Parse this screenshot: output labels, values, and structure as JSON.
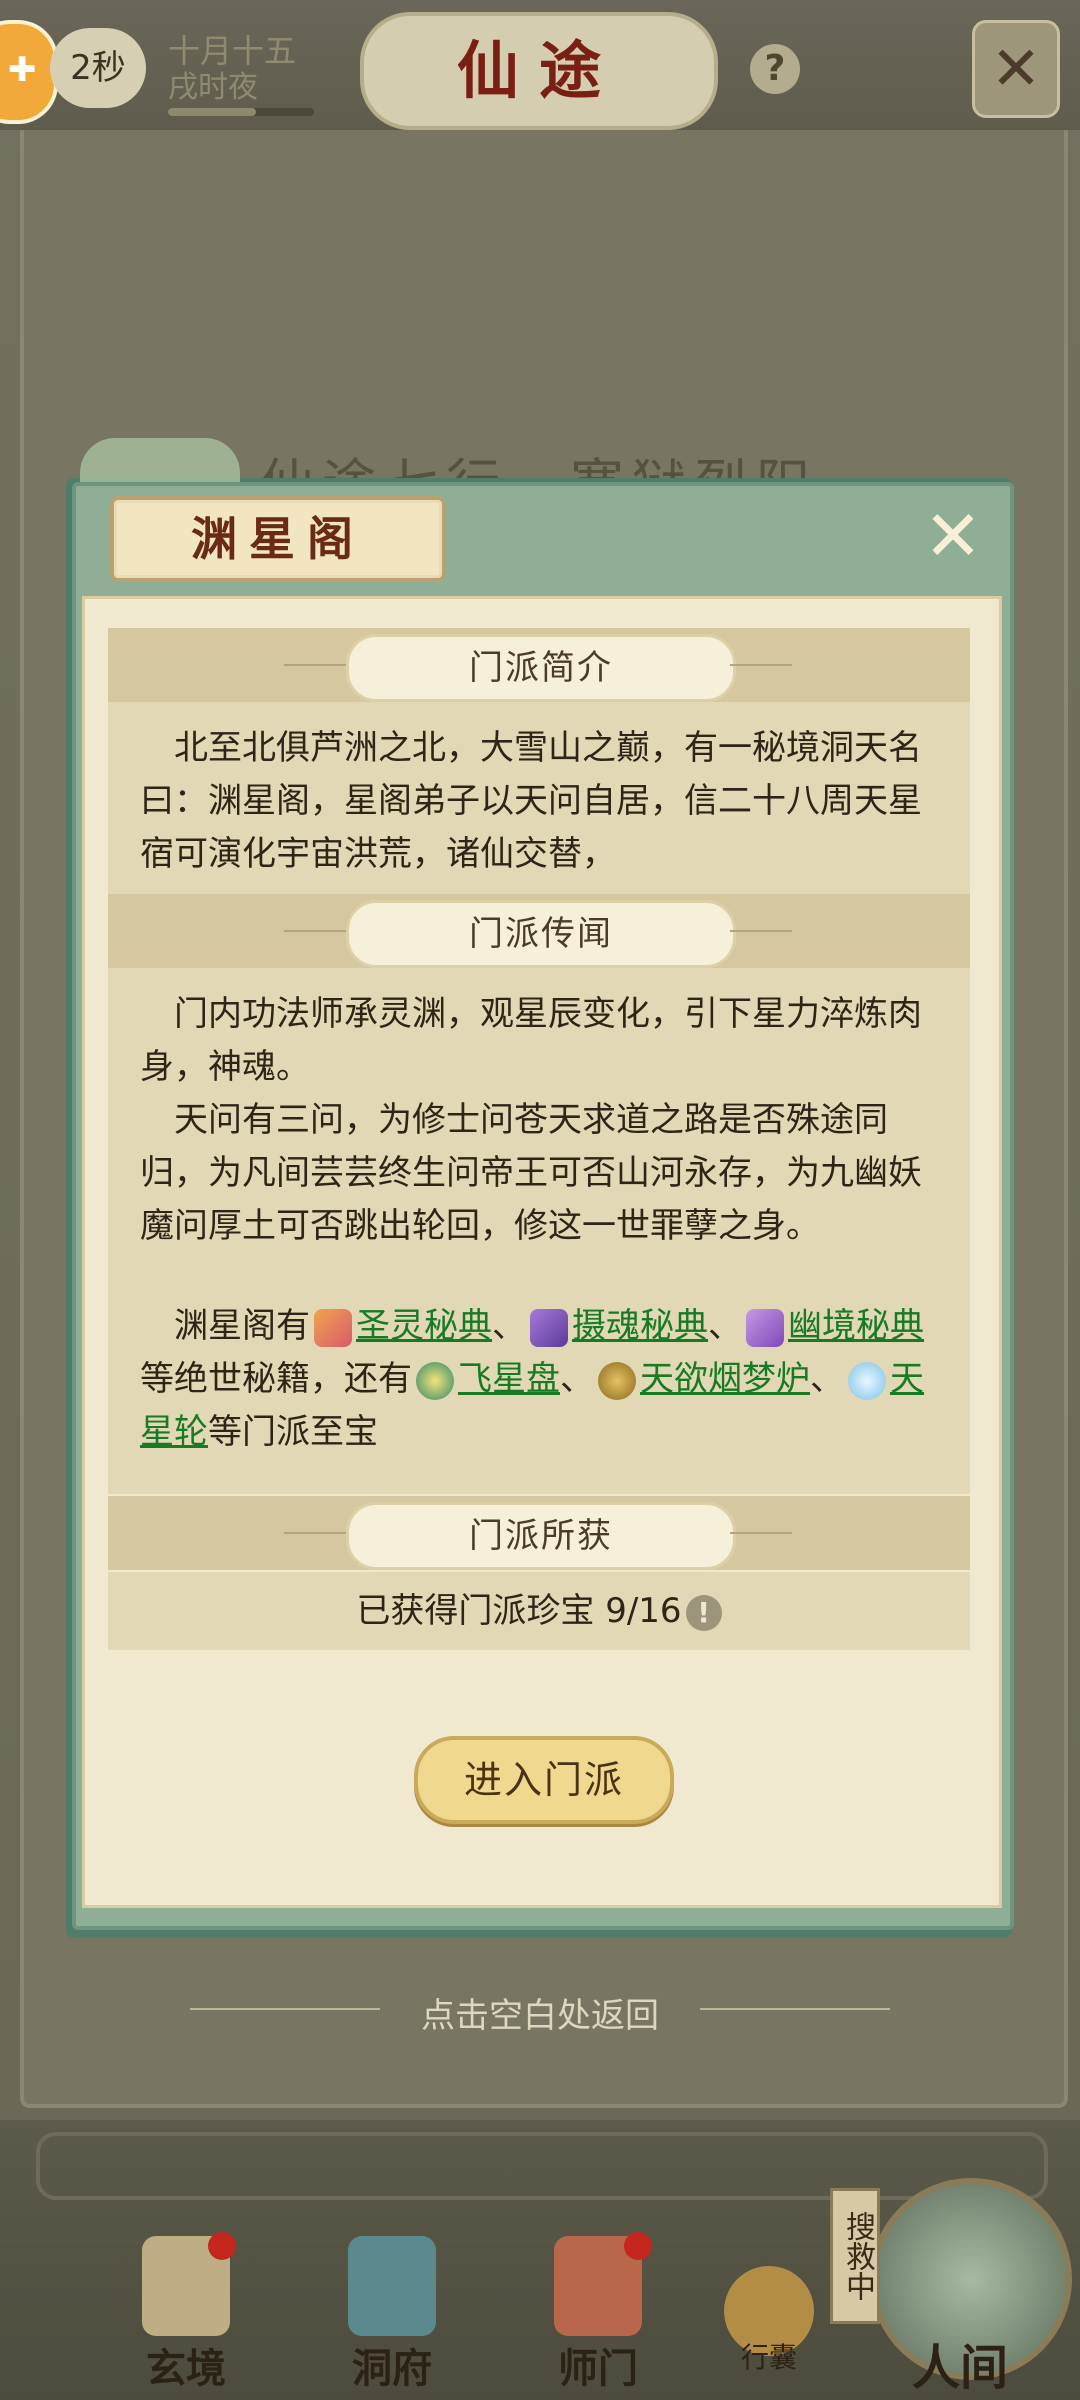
{
  "topbar": {
    "timer": "2秒",
    "date_line1": "十月十五",
    "date_line2": "戌时夜",
    "title": "仙途",
    "help": "?",
    "close": "✕"
  },
  "background": {
    "faded_title": "仙途七行　寒狱烈阳"
  },
  "modal": {
    "title": "渊星阁",
    "close": "✕",
    "sections": {
      "intro": {
        "header": "门派简介",
        "text": "北至北俱芦洲之北，大雪山之巅，有一秘境洞天名曰：渊星阁，星阁弟子以天问自居，信二十八周天星宿可演化宇宙洪荒，诸仙交替，"
      },
      "lore": {
        "header": "门派传闻",
        "para1": "门内功法师承灵渊，观星辰变化，引下星力淬炼肉身，神魂。",
        "para2": "天问有三问，为修士问苍天求道之路是否殊途同归，为凡间芸芸终生问帝王可否山河永存，为九幽妖魔问厚土可否跳出轮回，修这一世罪孽之身。",
        "para3_prefix": "渊星阁有",
        "link1": "圣灵秘典",
        "sep1": "、",
        "link2": "摄魂秘典",
        "sep2": "、",
        "link3": "幽境秘典",
        "mid": "等绝世秘籍，还有",
        "link4": "飞星盘",
        "sep3": "、",
        "link5": "天欲烟梦炉",
        "sep4": "、",
        "link6": "天星轮",
        "suffix": "等门派至宝"
      },
      "gains": {
        "header": "门派所获",
        "text": "已获得门派珍宝 9/16",
        "info_icon": "!"
      }
    },
    "enter_button": "进入门派"
  },
  "back_hint": "点击空白处返回",
  "bottom_nav": {
    "items": [
      {
        "label": "玄境"
      },
      {
        "label": "洞府"
      },
      {
        "label": "师门"
      }
    ],
    "bag": "行囊",
    "rescue": "搜救中",
    "world": "人间"
  }
}
